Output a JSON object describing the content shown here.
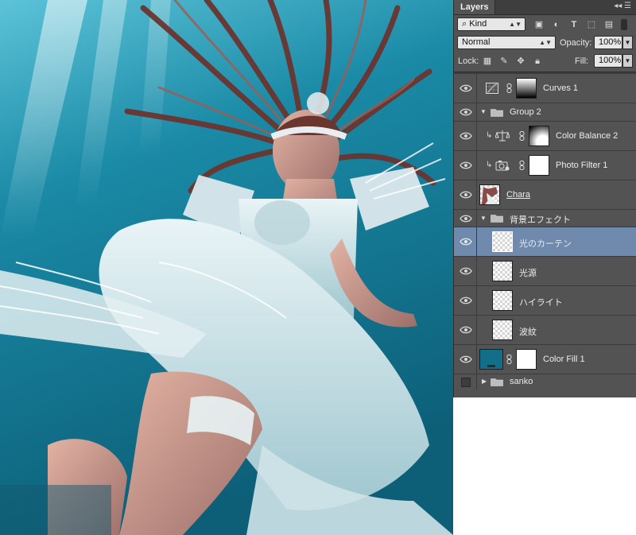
{
  "panel": {
    "tab_label": "Layers",
    "filter_kind": "Kind",
    "blend_mode": "Normal",
    "opacity_label": "Opacity:",
    "opacity_value": "100%",
    "lock_label": "Lock:",
    "fill_label": "Fill:",
    "fill_value": "100%"
  },
  "layers": [
    {
      "name": "Curves 1",
      "type": "adjustment-curves",
      "visible": true
    },
    {
      "name": "Group 2",
      "type": "group",
      "visible": true,
      "expanded": true
    },
    {
      "name": "Color Balance 2",
      "type": "adjustment-color-balance",
      "visible": true,
      "clipped": true
    },
    {
      "name": "Photo Filter 1",
      "type": "adjustment-photo-filter",
      "visible": true,
      "clipped": true
    },
    {
      "name": "Chara",
      "type": "pixel",
      "visible": true
    },
    {
      "name": "背景エフェクト",
      "type": "group",
      "visible": true,
      "expanded": true
    },
    {
      "name": "光のカーテン",
      "type": "pixel",
      "visible": true,
      "selected": true
    },
    {
      "name": "光源",
      "type": "pixel",
      "visible": true
    },
    {
      "name": "ハイライト",
      "type": "pixel",
      "visible": true
    },
    {
      "name": "波紋",
      "type": "pixel",
      "visible": true
    },
    {
      "name": "Color Fill 1",
      "type": "fill",
      "visible": true,
      "fill_color": "#136e8a"
    },
    {
      "name": "sanko",
      "type": "group",
      "visible": false,
      "expanded": false
    }
  ],
  "colors": {
    "panel_bg": "#535353",
    "selected_row": "#6f8aad",
    "water_teal": "#136e8a"
  }
}
